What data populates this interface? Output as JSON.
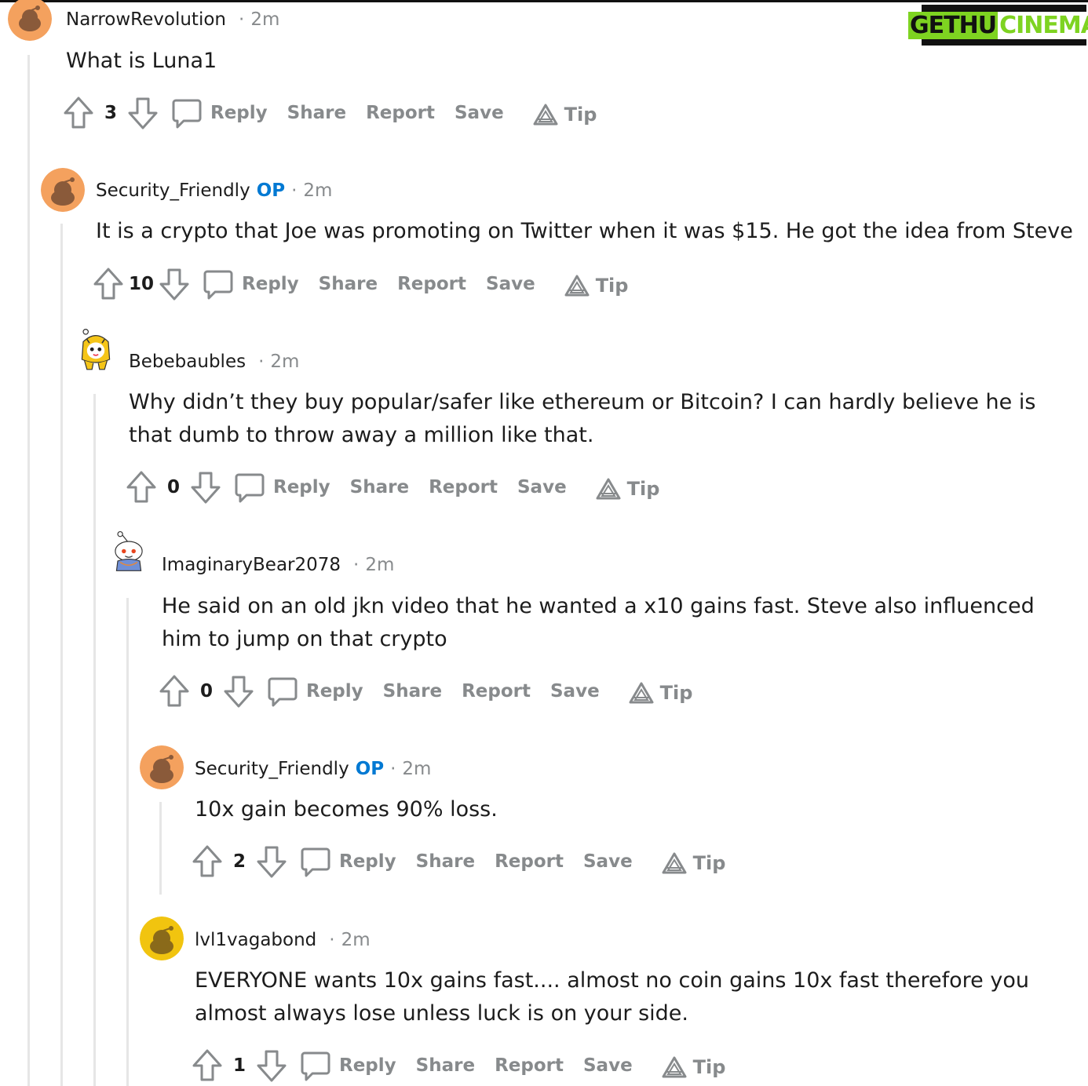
{
  "watermark": {
    "part1": "GETHU",
    "part2": "CINEMA"
  },
  "actions": {
    "reply": "Reply",
    "share": "Share",
    "report": "Report",
    "save": "Save",
    "tip": "Tip"
  },
  "comments": [
    {
      "username": "NarrowRevolution",
      "op": "",
      "time": "2m",
      "text": "What is Luna1",
      "score": "3"
    },
    {
      "username": "Security_Friendly",
      "op": "OP",
      "time": "2m",
      "text": "It is a crypto that Joe was promoting on Twitter when it was $15. He got the idea from Steve",
      "score": "10"
    },
    {
      "username": "Bebebaubles",
      "op": "",
      "time": "2m",
      "text": "Why didn’t they buy popular/safer like ethereum or Bitcoin? I can hardly believe he is that dumb to throw away a million like that.",
      "score": "0"
    },
    {
      "username": "ImaginaryBear2078",
      "op": "",
      "time": "2m",
      "text": "He said on an old jkn video that he wanted a x10 gains fast. Steve also influenced him to jump on that crypto",
      "score": "0"
    },
    {
      "username": "Security_Friendly",
      "op": "OP",
      "time": "2m",
      "text": "10x gain becomes 90% loss.",
      "score": "2"
    },
    {
      "username": "lvl1vagabond",
      "op": "",
      "time": "2m",
      "text": "EVERYONE wants 10x gains fast.... almost no coin gains 10x fast therefore you almost always lose unless luck is on your side.",
      "score": "1"
    }
  ],
  "colors": {
    "op": "#0079d3",
    "muted": "#878a8c",
    "avatar_orange": "#f4a15e",
    "avatar_yellow": "#f1c40f"
  }
}
